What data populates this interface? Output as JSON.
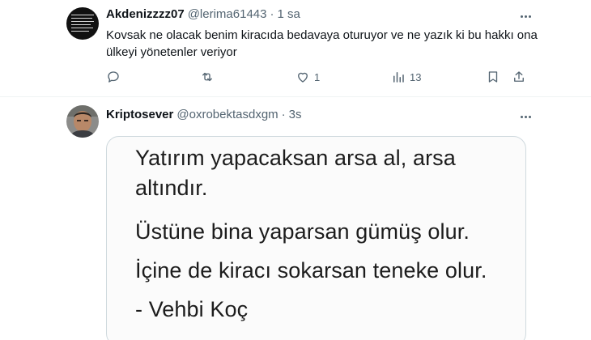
{
  "tweet1": {
    "display_name": "Akdenizzzz07",
    "handle": "@lerima61443",
    "separator": "·",
    "time": "1 sa",
    "text": "Kovsak ne olacak benim kiracıda bedavaya oturuyor ve ne yazık ki bu hakkı ona ülkeyi yönetenler veriyor",
    "likes": "1",
    "views": "13"
  },
  "tweet2": {
    "display_name": "Kriptosever",
    "handle": "@oxrobektasdxgm",
    "separator": "·",
    "time": "3s",
    "quote_lines": [
      "Yatırım yapacaksan arsa al, arsa",
      "altındır.",
      "Üstüne bina yaparsan gümüş olur.",
      "İçine de kiracı sokarsan teneke olur.",
      "- Vehbi Koç"
    ]
  },
  "colors": {
    "text": "#0f1419",
    "secondary": "#536471",
    "border": "#eff3f4"
  },
  "icons": [
    "more-icon",
    "reply-icon",
    "retweet-icon",
    "like-icon",
    "views-icon",
    "bookmark-icon",
    "share-icon"
  ]
}
